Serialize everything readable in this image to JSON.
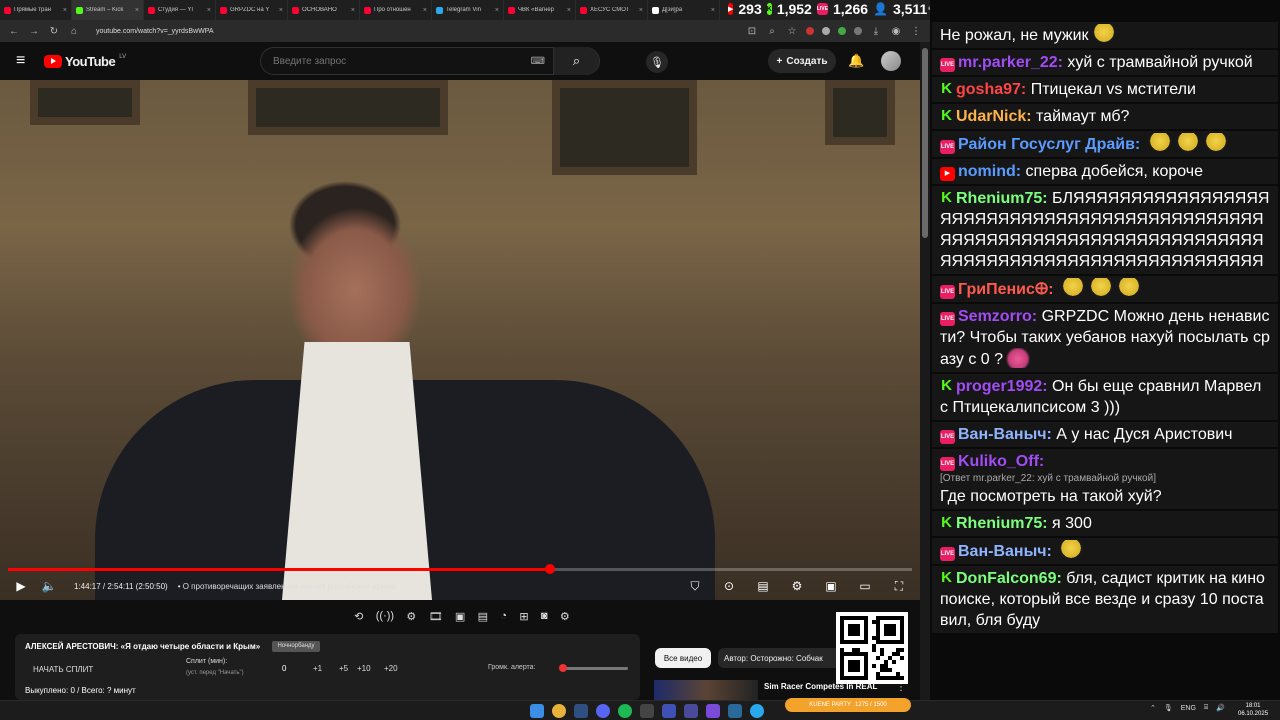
{
  "browser": {
    "tabs": [
      {
        "label": "Прямые тран",
        "color": "#ff0033"
      },
      {
        "label": "Stream – Kick",
        "color": "#53fc18"
      },
      {
        "label": "Студия — YI",
        "color": "#ff0033"
      },
      {
        "label": "GRPZDC на Y",
        "color": "#ff0033"
      },
      {
        "label": "ОСНОВАНО",
        "color": "#ff0033"
      },
      {
        "label": "Про отношен",
        "color": "#ff0033"
      },
      {
        "label": "Telegram Vin",
        "color": "#29a9eb"
      },
      {
        "label": "ЧВК «Вагнер",
        "color": "#ff0033"
      },
      {
        "label": "ХЕСУС СМОТ",
        "color": "#ff0033"
      },
      {
        "label": "Д[зи]ра",
        "color": "#ffffff"
      }
    ],
    "url": "youtube.com/watch?v=_yyrdsBwWPA"
  },
  "stats": {
    "youtube_viewers": "293",
    "kick_viewers": "1,952",
    "live_viewers": "1,266",
    "total_viewers": "3,511",
    "chat_label": "eChat"
  },
  "youtube": {
    "logo_text": "YouTube",
    "region": "LV",
    "search_placeholder": "Введите запрос",
    "create_label": "Создать"
  },
  "player": {
    "time": "1:44:17 / 2:54:11 (2:50:50)",
    "chapter": "• О противоречащих заявлениях насчет российской армии",
    "progress": 0.6
  },
  "panel": {
    "title": "АЛЕКСЕЙ АРЕСТОВИЧ: «Я отдаю четыре области и Крым»",
    "badge": "Ночнорбанду",
    "start_label": "НАЧАТЬ СПЛИТ",
    "split_label": "Сплит (мин):",
    "split_hint": "(уст. перед \"Начать\")",
    "split_value": "0",
    "increments": [
      "+1",
      "+5",
      "+10",
      "+20"
    ],
    "volume_label": "Громк. алерта:",
    "volume_level": 0.05,
    "bought_label": "Выкуплено: 0 / Всего: ? минут"
  },
  "recs": {
    "chip_all": "Все видео",
    "chip_author": "Автор: Осторожно: Собчак",
    "video_title": "Sim Racer Competes In REAL"
  },
  "game_bar": {
    "label": "KUENE PARTY",
    "value": "1275 / 1500"
  },
  "chat": [
    {
      "platform": "",
      "nick": "",
      "nick_color": "#ffffff",
      "text": "Не рожал, не мужик",
      "emotes": 1,
      "emote_type": "face",
      "reply": ""
    },
    {
      "platform": "live",
      "nick": "mr.parker_22:",
      "nick_color": "#a24cf4",
      "text": "хуй с трамвайной ручкой",
      "emotes": 0,
      "emote_type": "",
      "reply": ""
    },
    {
      "platform": "kick",
      "nick": "gosha97:",
      "nick_color": "#ff4545",
      "text": "Птицекал vs мстители",
      "emotes": 0,
      "emote_type": "",
      "reply": ""
    },
    {
      "platform": "kick",
      "nick": "UdarNick:",
      "nick_color": "#ffb24a",
      "text": "таймаут мб?",
      "emotes": 0,
      "emote_type": "",
      "reply": ""
    },
    {
      "platform": "live",
      "nick": "Район Госуслуг Драйв:",
      "nick_color": "#5b9bff",
      "text": "",
      "emotes": 3,
      "emote_type": "face",
      "reply": ""
    },
    {
      "platform": "yt",
      "nick": "nomind:",
      "nick_color": "#5b9bff",
      "text": "сперва добейся, короче",
      "emotes": 0,
      "emote_type": "",
      "reply": ""
    },
    {
      "platform": "kick",
      "nick": "Rhenium75:",
      "nick_color": "#7dff7d",
      "text": "БЛЯЯЯЯЯЯЯЯЯЯЯЯЯЯЯЯЯЯЯЯЯЯЯЯЯЯЯЯЯЯЯЯЯЯЯЯЯЯЯЯЯЯЯЯЯЯЯЯЯЯЯЯЯЯЯЯЯЯЯЯЯЯЯЯЯЯЯЯЯЯЯЯЯЯЯЯЯЯЯЯЯЯЯЯЯЯЯЯЯЯЯЯЯЯЯЯЯЯЯЯЯ",
      "emotes": 0,
      "emote_type": "",
      "reply": ""
    },
    {
      "platform": "live",
      "nick": "ГриПенис🜨:",
      "nick_color": "#ff5a4f",
      "text": "",
      "emotes": 3,
      "emote_type": "face",
      "reply": ""
    },
    {
      "platform": "live",
      "nick": "Semzorro:",
      "nick_color": "#a24cf4",
      "text": "GRPZDC Можно день ненависти? Чтобы таких уебанов нахуй посылать сразу с 0 ?",
      "emotes": 1,
      "emote_type": "pig",
      "reply": ""
    },
    {
      "platform": "kick",
      "nick": "proger1992:",
      "nick_color": "#a24cf4",
      "text": "Он бы еще сравнил Марвел с Птицекалипсисом 3 )))",
      "emotes": 0,
      "emote_type": "",
      "reply": ""
    },
    {
      "platform": "live",
      "nick": "Ван-Ваныч:",
      "nick_color": "#8fb4ff",
      "text": "А у нас Дуся Аристович",
      "emotes": 0,
      "emote_type": "",
      "reply": ""
    },
    {
      "platform": "live",
      "nick": "Kuliko_Off:",
      "nick_color": "#a24cf4",
      "text": "Где посмотреть на такой хуй?",
      "emotes": 0,
      "emote_type": "",
      "reply": "[Ответ mr.parker_22: хуй с трамвайной ручкой]"
    },
    {
      "platform": "kick",
      "nick": "Rhenium75:",
      "nick_color": "#7dff7d",
      "text": "я 300",
      "emotes": 0,
      "emote_type": "",
      "reply": ""
    },
    {
      "platform": "live",
      "nick": "Ван-Ваныч:",
      "nick_color": "#8fb4ff",
      "text": "",
      "emotes": 1,
      "emote_type": "face",
      "reply": ""
    },
    {
      "platform": "kick",
      "nick": "DonFalcon69:",
      "nick_color": "#7dff7d",
      "text": "бля, садист критик на кинопоиске, который все везде и сразу 10 поставил, бля буду",
      "emotes": 0,
      "emote_type": "",
      "reply": ""
    }
  ],
  "taskbar": {
    "lang": "ENG",
    "time": "18:01",
    "date": "06.10.2025"
  }
}
